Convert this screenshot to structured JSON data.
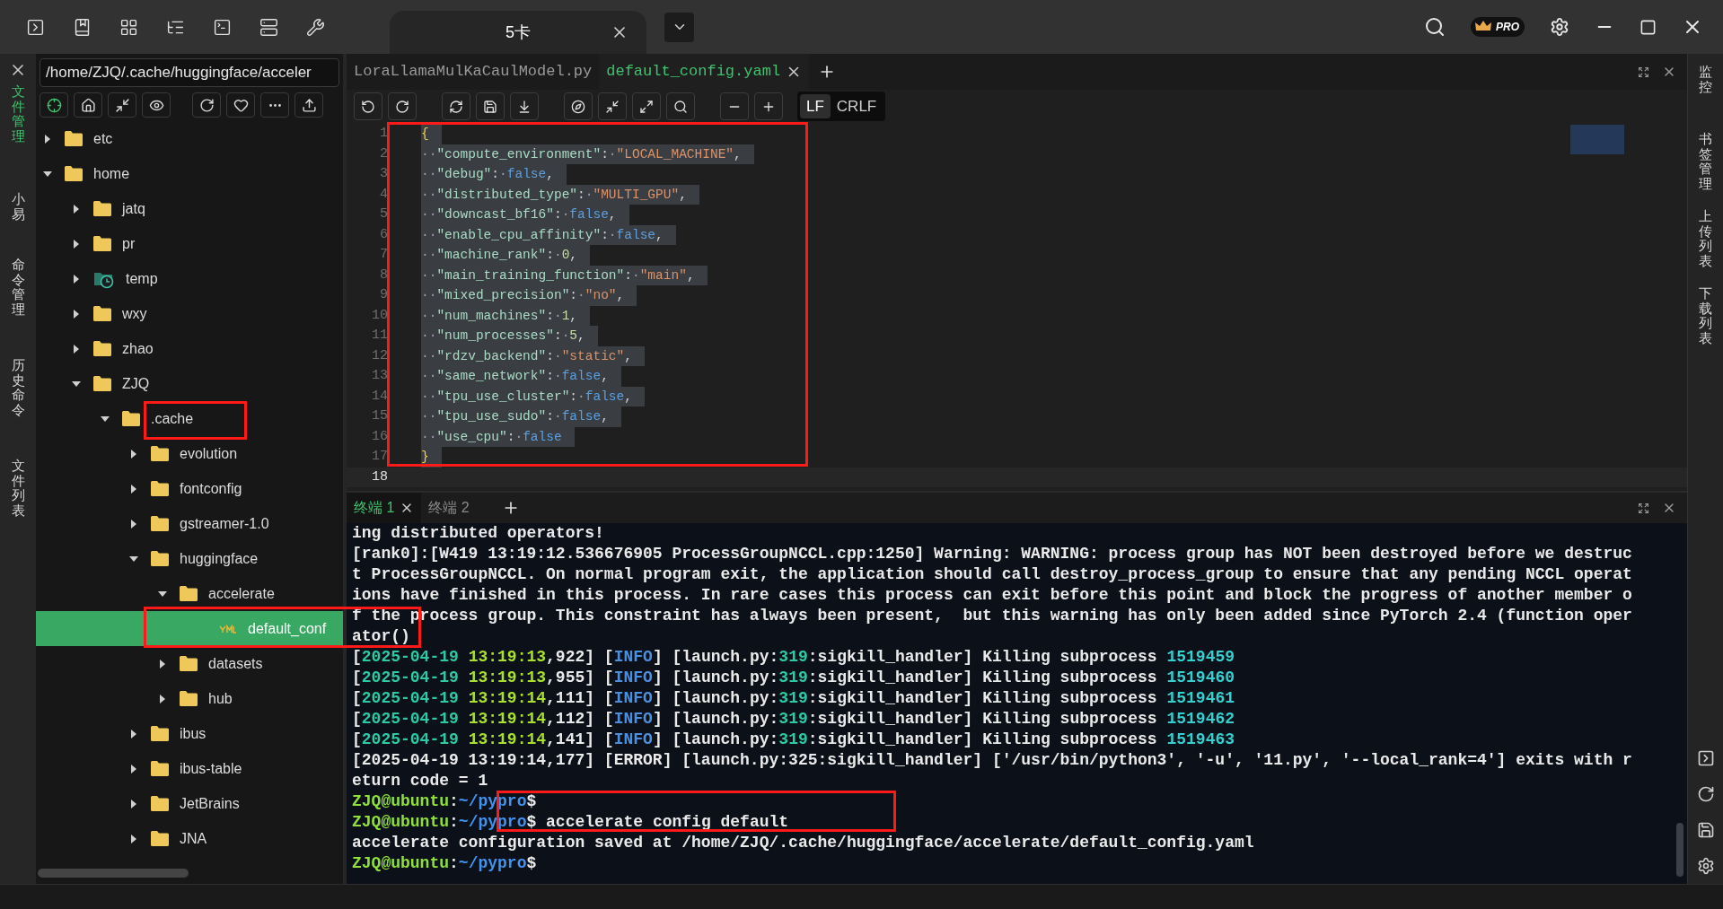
{
  "title_bar": {
    "session_tab": {
      "label": "5卡",
      "selected": true
    },
    "pro_badge": "PRO"
  },
  "left_rail": [
    {
      "label": "文件管理",
      "selected": true
    },
    {
      "label": "小易",
      "selected": false
    },
    {
      "label": "命令管理",
      "selected": false
    },
    {
      "label": "历史命令",
      "selected": false
    },
    {
      "label": "文件列表",
      "selected": false
    }
  ],
  "file_panel": {
    "path": "/home/ZJQ/.cache/huggingface/acceler",
    "tree": [
      {
        "name": "etc",
        "kind": "folder",
        "expanded": false,
        "selected": false
      },
      {
        "name": "home",
        "kind": "folder",
        "expanded": true,
        "selected": false,
        "children": [
          {
            "name": "jatq",
            "kind": "folder",
            "expanded": false,
            "selected": false
          },
          {
            "name": "pr",
            "kind": "folder",
            "expanded": false,
            "selected": false
          },
          {
            "name": "temp",
            "kind": "clock-folder",
            "expanded": false,
            "selected": false
          },
          {
            "name": "wxy",
            "kind": "folder",
            "expanded": false,
            "selected": false
          },
          {
            "name": "zhao",
            "kind": "folder",
            "expanded": false,
            "selected": false
          },
          {
            "name": "ZJQ",
            "kind": "folder",
            "expanded": true,
            "selected": false,
            "children": [
              {
                "name": ".cache",
                "kind": "folder",
                "expanded": true,
                "selected": false,
                "children": [
                  {
                    "name": "evolution",
                    "kind": "folder",
                    "expanded": false,
                    "selected": false
                  },
                  {
                    "name": "fontconfig",
                    "kind": "folder",
                    "expanded": false,
                    "selected": false
                  },
                  {
                    "name": "gstreamer-1.0",
                    "kind": "folder",
                    "expanded": false,
                    "selected": false
                  },
                  {
                    "name": "huggingface",
                    "kind": "folder",
                    "expanded": true,
                    "selected": false,
                    "children": [
                      {
                        "name": "accelerate",
                        "kind": "folder",
                        "expanded": true,
                        "selected": false,
                        "children": [
                          {
                            "name": "default_conf",
                            "kind": "yaml",
                            "selected": true
                          }
                        ]
                      },
                      {
                        "name": "datasets",
                        "kind": "folder",
                        "expanded": false,
                        "selected": false
                      },
                      {
                        "name": "hub",
                        "kind": "folder",
                        "expanded": false,
                        "selected": false
                      }
                    ]
                  },
                  {
                    "name": "ibus",
                    "kind": "folder",
                    "expanded": false,
                    "selected": false
                  },
                  {
                    "name": "ibus-table",
                    "kind": "folder",
                    "expanded": false,
                    "selected": false
                  },
                  {
                    "name": "JetBrains",
                    "kind": "folder",
                    "expanded": false,
                    "selected": false
                  },
                  {
                    "name": "JNA",
                    "kind": "folder",
                    "expanded": false,
                    "selected": false
                  }
                ]
              }
            ]
          }
        ]
      }
    ]
  },
  "editor": {
    "tabs": [
      {
        "label": "LoraLlamaMulKaCaulModel.py",
        "selected": false
      },
      {
        "label": "default_config.yaml",
        "selected": true
      }
    ],
    "eol": [
      {
        "label": "LF",
        "selected": true
      },
      {
        "label": "CRLF",
        "selected": false
      }
    ],
    "lines": [
      {
        "number": "1",
        "selected": true,
        "segments": [
          {
            "kind": "brace",
            "text": "{"
          }
        ]
      },
      {
        "number": "2",
        "selected": true,
        "segments": [
          {
            "kind": "ws",
            "text": "··"
          },
          {
            "kind": "key",
            "text": "\"compute_environment\""
          },
          {
            "kind": "punct",
            "text": ":"
          },
          {
            "kind": "ws",
            "text": "·"
          },
          {
            "kind": "string",
            "text": "\"LOCAL_MACHINE\""
          },
          {
            "kind": "punct",
            "text": ","
          }
        ]
      },
      {
        "number": "3",
        "selected": true,
        "segments": [
          {
            "kind": "ws",
            "text": "··"
          },
          {
            "kind": "key",
            "text": "\"debug\""
          },
          {
            "kind": "punct",
            "text": ":"
          },
          {
            "kind": "ws",
            "text": "·"
          },
          {
            "kind": "bool",
            "text": "false"
          },
          {
            "kind": "punct",
            "text": ","
          }
        ]
      },
      {
        "number": "4",
        "selected": true,
        "segments": [
          {
            "kind": "ws",
            "text": "··"
          },
          {
            "kind": "key",
            "text": "\"distributed_type\""
          },
          {
            "kind": "punct",
            "text": ":"
          },
          {
            "kind": "ws",
            "text": "·"
          },
          {
            "kind": "string",
            "text": "\"MULTI_GPU\""
          },
          {
            "kind": "punct",
            "text": ","
          }
        ]
      },
      {
        "number": "5",
        "selected": true,
        "segments": [
          {
            "kind": "ws",
            "text": "··"
          },
          {
            "kind": "key",
            "text": "\"downcast_bf16\""
          },
          {
            "kind": "punct",
            "text": ":"
          },
          {
            "kind": "ws",
            "text": "·"
          },
          {
            "kind": "bool",
            "text": "false"
          },
          {
            "kind": "punct",
            "text": ","
          }
        ]
      },
      {
        "number": "6",
        "selected": true,
        "segments": [
          {
            "kind": "ws",
            "text": "··"
          },
          {
            "kind": "key",
            "text": "\"enable_cpu_affinity\""
          },
          {
            "kind": "punct",
            "text": ":"
          },
          {
            "kind": "ws",
            "text": "·"
          },
          {
            "kind": "bool",
            "text": "false"
          },
          {
            "kind": "punct",
            "text": ","
          }
        ]
      },
      {
        "number": "7",
        "selected": true,
        "segments": [
          {
            "kind": "ws",
            "text": "··"
          },
          {
            "kind": "key",
            "text": "\"machine_rank\""
          },
          {
            "kind": "punct",
            "text": ":"
          },
          {
            "kind": "ws",
            "text": "·"
          },
          {
            "kind": "number",
            "text": "0"
          },
          {
            "kind": "punct",
            "text": ","
          }
        ]
      },
      {
        "number": "8",
        "selected": true,
        "segments": [
          {
            "kind": "ws",
            "text": "··"
          },
          {
            "kind": "key",
            "text": "\"main_training_function\""
          },
          {
            "kind": "punct",
            "text": ":"
          },
          {
            "kind": "ws",
            "text": "·"
          },
          {
            "kind": "string",
            "text": "\"main\""
          },
          {
            "kind": "punct",
            "text": ","
          }
        ]
      },
      {
        "number": "9",
        "selected": true,
        "segments": [
          {
            "kind": "ws",
            "text": "··"
          },
          {
            "kind": "key",
            "text": "\"mixed_precision\""
          },
          {
            "kind": "punct",
            "text": ":"
          },
          {
            "kind": "ws",
            "text": "·"
          },
          {
            "kind": "string",
            "text": "\"no\""
          },
          {
            "kind": "punct",
            "text": ","
          }
        ]
      },
      {
        "number": "10",
        "selected": true,
        "segments": [
          {
            "kind": "ws",
            "text": "··"
          },
          {
            "kind": "key",
            "text": "\"num_machines\""
          },
          {
            "kind": "punct",
            "text": ":"
          },
          {
            "kind": "ws",
            "text": "·"
          },
          {
            "kind": "number",
            "text": "1"
          },
          {
            "kind": "punct",
            "text": ","
          }
        ]
      },
      {
        "number": "11",
        "selected": true,
        "segments": [
          {
            "kind": "ws",
            "text": "··"
          },
          {
            "kind": "key",
            "text": "\"num_processes\""
          },
          {
            "kind": "punct",
            "text": ":"
          },
          {
            "kind": "ws",
            "text": "·"
          },
          {
            "kind": "number",
            "text": "5"
          },
          {
            "kind": "punct",
            "text": ","
          }
        ]
      },
      {
        "number": "12",
        "selected": true,
        "segments": [
          {
            "kind": "ws",
            "text": "··"
          },
          {
            "kind": "key",
            "text": "\"rdzv_backend\""
          },
          {
            "kind": "punct",
            "text": ":"
          },
          {
            "kind": "ws",
            "text": "·"
          },
          {
            "kind": "string",
            "text": "\"static\""
          },
          {
            "kind": "punct",
            "text": ","
          }
        ]
      },
      {
        "number": "13",
        "selected": true,
        "segments": [
          {
            "kind": "ws",
            "text": "··"
          },
          {
            "kind": "key",
            "text": "\"same_network\""
          },
          {
            "kind": "punct",
            "text": ":"
          },
          {
            "kind": "ws",
            "text": "·"
          },
          {
            "kind": "bool",
            "text": "false"
          },
          {
            "kind": "punct",
            "text": ","
          }
        ]
      },
      {
        "number": "14",
        "selected": true,
        "segments": [
          {
            "kind": "ws",
            "text": "··"
          },
          {
            "kind": "key",
            "text": "\"tpu_use_cluster\""
          },
          {
            "kind": "punct",
            "text": ":"
          },
          {
            "kind": "ws",
            "text": "·"
          },
          {
            "kind": "bool",
            "text": "false"
          },
          {
            "kind": "punct",
            "text": ","
          }
        ]
      },
      {
        "number": "15",
        "selected": true,
        "segments": [
          {
            "kind": "ws",
            "text": "··"
          },
          {
            "kind": "key",
            "text": "\"tpu_use_sudo\""
          },
          {
            "kind": "punct",
            "text": ":"
          },
          {
            "kind": "ws",
            "text": "·"
          },
          {
            "kind": "bool",
            "text": "false"
          },
          {
            "kind": "punct",
            "text": ","
          }
        ]
      },
      {
        "number": "16",
        "selected": true,
        "segments": [
          {
            "kind": "ws",
            "text": "··"
          },
          {
            "kind": "key",
            "text": "\"use_cpu\""
          },
          {
            "kind": "punct",
            "text": ":"
          },
          {
            "kind": "ws",
            "text": "·"
          },
          {
            "kind": "bool",
            "text": "false"
          }
        ]
      },
      {
        "number": "17",
        "selected": true,
        "segments": [
          {
            "kind": "brace",
            "text": "}"
          }
        ]
      },
      {
        "number": "18",
        "selected": false
      }
    ]
  },
  "terminal": {
    "tabs": [
      {
        "label": "终端 1",
        "selected": true
      },
      {
        "label": "终端 2",
        "selected": false
      }
    ],
    "lines": [
      [
        {
          "kind": "plain",
          "text": "ing distributed operators!"
        }
      ],
      [
        {
          "kind": "plain",
          "text": "[rank0]:[W419 13:19:12.536676905 ProcessGroupNCCL.cpp:1250] Warning: WARNING: process group has NOT been destroyed before we destruc"
        }
      ],
      [
        {
          "kind": "plain",
          "text": "t ProcessGroupNCCL. On normal program exit, the application should call destroy_process_group to ensure that any pending NCCL operat"
        }
      ],
      [
        {
          "kind": "plain",
          "text": "ions have finished in this process. In rare cases this process can exit before this point and block the progress of another member o"
        }
      ],
      [
        {
          "kind": "plain",
          "text": "f the process group. This constraint has always been present,  but this warning has only been added since PyTorch 2.4 (function oper"
        }
      ],
      [
        {
          "kind": "plain",
          "text": "ator()"
        }
      ],
      [
        {
          "kind": "plain",
          "text": "["
        },
        {
          "kind": "date",
          "text": "2025-04-19"
        },
        {
          "kind": "time",
          "text": " 13:19:13"
        },
        {
          "kind": "plain",
          "text": ",922] ["
        },
        {
          "kind": "info",
          "text": "INFO"
        },
        {
          "kind": "plain",
          "text": "] [launch.py:"
        },
        {
          "kind": "date",
          "text": "319"
        },
        {
          "kind": "plain",
          "text": ":sigkill_handler] Killing subprocess "
        },
        {
          "kind": "pid",
          "text": "1519459"
        }
      ],
      [
        {
          "kind": "plain",
          "text": "["
        },
        {
          "kind": "date",
          "text": "2025-04-19"
        },
        {
          "kind": "time",
          "text": " 13:19:13"
        },
        {
          "kind": "plain",
          "text": ",955] ["
        },
        {
          "kind": "info",
          "text": "INFO"
        },
        {
          "kind": "plain",
          "text": "] [launch.py:"
        },
        {
          "kind": "date",
          "text": "319"
        },
        {
          "kind": "plain",
          "text": ":sigkill_handler] Killing subprocess "
        },
        {
          "kind": "pid",
          "text": "1519460"
        }
      ],
      [
        {
          "kind": "plain",
          "text": "["
        },
        {
          "kind": "date",
          "text": "2025-04-19"
        },
        {
          "kind": "time",
          "text": " 13:19:14"
        },
        {
          "kind": "plain",
          "text": ",111] ["
        },
        {
          "kind": "info",
          "text": "INFO"
        },
        {
          "kind": "plain",
          "text": "] [launch.py:"
        },
        {
          "kind": "date",
          "text": "319"
        },
        {
          "kind": "plain",
          "text": ":sigkill_handler] Killing subprocess "
        },
        {
          "kind": "pid",
          "text": "1519461"
        }
      ],
      [
        {
          "kind": "plain",
          "text": "["
        },
        {
          "kind": "date",
          "text": "2025-04-19"
        },
        {
          "kind": "time",
          "text": " 13:19:14"
        },
        {
          "kind": "plain",
          "text": ",112] ["
        },
        {
          "kind": "info",
          "text": "INFO"
        },
        {
          "kind": "plain",
          "text": "] [launch.py:"
        },
        {
          "kind": "date",
          "text": "319"
        },
        {
          "kind": "plain",
          "text": ":sigkill_handler] Killing subprocess "
        },
        {
          "kind": "pid",
          "text": "1519462"
        }
      ],
      [
        {
          "kind": "plain",
          "text": "["
        },
        {
          "kind": "date",
          "text": "2025-04-19"
        },
        {
          "kind": "time",
          "text": " 13:19:14"
        },
        {
          "kind": "plain",
          "text": ",141] ["
        },
        {
          "kind": "info",
          "text": "INFO"
        },
        {
          "kind": "plain",
          "text": "] [launch.py:"
        },
        {
          "kind": "date",
          "text": "319"
        },
        {
          "kind": "plain",
          "text": ":sigkill_handler] Killing subprocess "
        },
        {
          "kind": "pid",
          "text": "1519463"
        }
      ],
      [
        {
          "kind": "plain",
          "text": "[2025-04-19 13:19:14,177] [ERROR] [launch.py:325:sigkill_handler] ['/usr/bin/python3', '-u', '11.py', '--local_rank=4'] exits with r"
        }
      ],
      [
        {
          "kind": "plain",
          "text": "eturn code = 1"
        }
      ],
      [
        {
          "kind": "user",
          "text": "ZJQ@ubuntu"
        },
        {
          "kind": "plain",
          "text": ":"
        },
        {
          "kind": "path",
          "text": "~/pypro"
        },
        {
          "kind": "plain",
          "text": "$"
        }
      ],
      [
        {
          "kind": "user",
          "text": "ZJQ@ubuntu"
        },
        {
          "kind": "plain",
          "text": ":"
        },
        {
          "kind": "path",
          "text": "~/pypro"
        },
        {
          "kind": "plain",
          "text": "$ accelerate config default"
        }
      ],
      [
        {
          "kind": "plain",
          "text": "accelerate configuration saved at /home/ZJQ/.cache/huggingface/accelerate/default_config.yaml"
        }
      ],
      [
        {
          "kind": "user",
          "text": "ZJQ@ubuntu"
        },
        {
          "kind": "plain",
          "text": ":"
        },
        {
          "kind": "path",
          "text": "~/pypro"
        },
        {
          "kind": "plain",
          "text": "$"
        }
      ]
    ]
  },
  "right_rail": [
    {
      "label": "监控"
    },
    {
      "label": "书签管理"
    },
    {
      "label": "上传列表"
    },
    {
      "label": "下载列表"
    }
  ],
  "annotations": [
    {
      "kind": "red-box"
    },
    {
      "kind": "red-box"
    },
    {
      "kind": "red-box"
    },
    {
      "kind": "red-box"
    }
  ]
}
